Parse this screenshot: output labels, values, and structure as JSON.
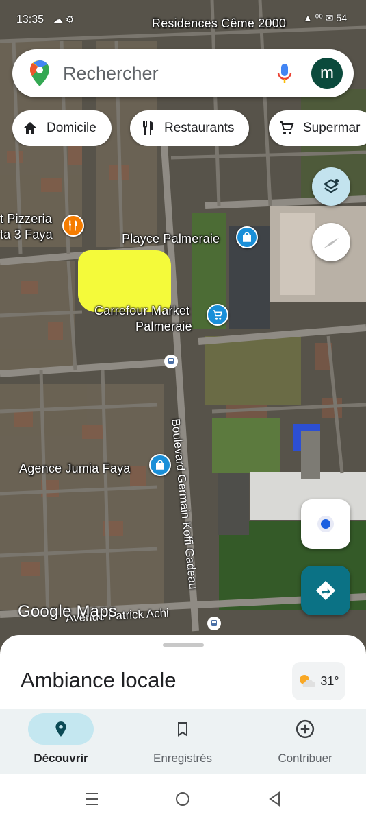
{
  "status": {
    "time": "13:35",
    "left_icons": "☁ ⚙",
    "right_text": "▲ ⁰⁰ ✉ 54"
  },
  "search": {
    "placeholder": "Rechercher",
    "avatar_letter": "m"
  },
  "chips": [
    {
      "label": "Domicile",
      "icon": "home-icon"
    },
    {
      "label": "Restaurants",
      "icon": "fork-knife-icon"
    },
    {
      "label": "Supermar",
      "icon": "cart-icon"
    }
  ],
  "map": {
    "labels": {
      "residences": "Residences Cême 2000",
      "pizzeria_1": "t Pizzeria",
      "pizzeria_2": "ta 3 Faya",
      "playce": "Playce Palmeraie",
      "carrefour_1": "Carrefour Market",
      "carrefour_2": "Palmeraie",
      "jumia": "Agence Jumia Faya",
      "boulevard": "Boulevard Germain Koffi Gadeau",
      "avenue": "Avenue Patrick Achi"
    },
    "attribution": "Google Maps",
    "colors": {
      "restaurant_pin": "#f57c00",
      "shop_pin": "#1a8fd8",
      "directions_fab": "#0b7285",
      "location_dot": "#1a5fe0"
    }
  },
  "sheet": {
    "title": "Ambiance locale",
    "weather_temp": "31°"
  },
  "nav": [
    {
      "label": "Découvrir",
      "icon": "pin-icon",
      "active": true
    },
    {
      "label": "Enregistrés",
      "icon": "bookmark-icon",
      "active": false
    },
    {
      "label": "Contribuer",
      "icon": "add-circle-icon",
      "active": false
    }
  ]
}
